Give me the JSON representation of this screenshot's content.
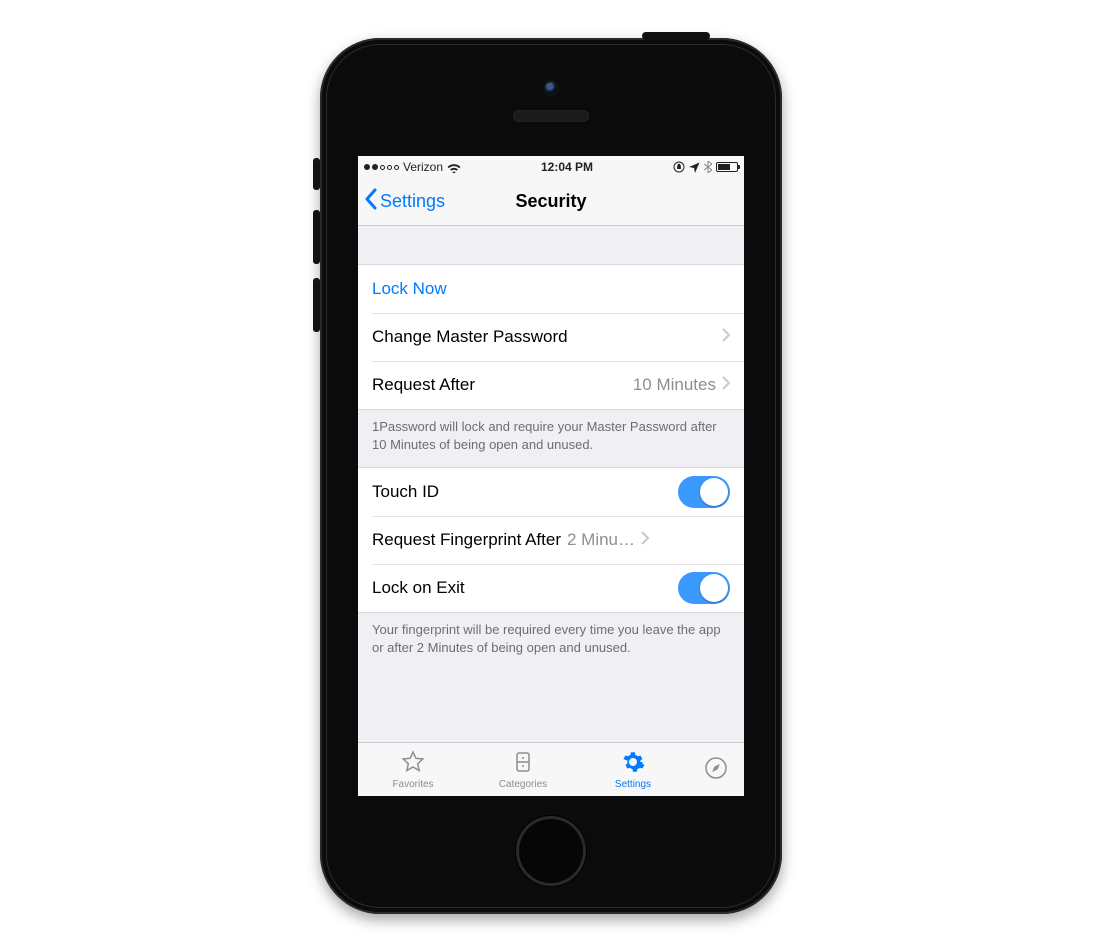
{
  "status": {
    "carrier": "Verizon",
    "time": "12:04 PM"
  },
  "nav": {
    "back_label": "Settings",
    "title": "Security"
  },
  "group1": {
    "lock_now": "Lock Now",
    "change_master": "Change Master Password",
    "request_after_label": "Request After",
    "request_after_value": "10 Minutes",
    "footer": "1Password will lock and require your Master Password after 10 Minutes of being open and unused."
  },
  "group2": {
    "touch_id": "Touch ID",
    "fingerprint_label": "Request Fingerprint After",
    "fingerprint_value": "2 Minu…",
    "lock_on_exit": "Lock on Exit",
    "footer": "Your fingerprint will be required every time you leave the app or after 2 Minutes of being open and unused."
  },
  "tabs": {
    "favorites": "Favorites",
    "categories": "Categories",
    "settings": "Settings"
  }
}
